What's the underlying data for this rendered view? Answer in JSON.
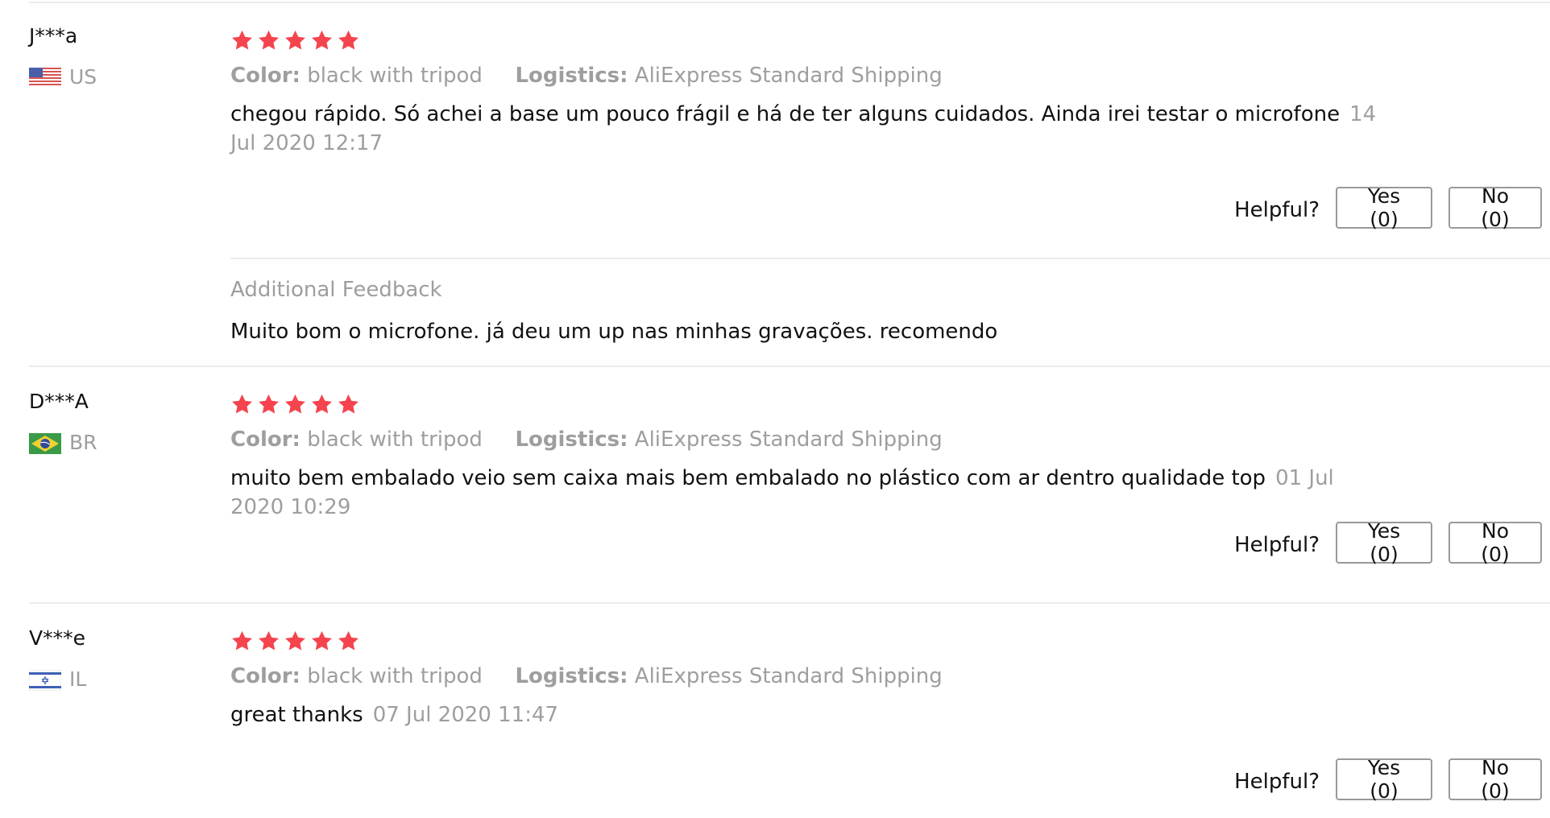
{
  "colors": {
    "star": "#f5444e",
    "muted_text": "#9e9e9e",
    "divider": "#ececec",
    "button_border": "#999999"
  },
  "rating_max": 5,
  "reviews": [
    {
      "user": "J***a",
      "country_code": "US",
      "flag_icon": "us-flag-icon",
      "rating": 5,
      "color_label": "Color:",
      "color_value": "black with tripod",
      "logistics_label": "Logistics:",
      "logistics_value": "AliExpress Standard Shipping",
      "text": "chegou rápido. Só achei a base um pouco frágil e há de ter alguns cuidados. Ainda irei testar o microfone",
      "date": "14 Jul 2020 12:17",
      "helpful_label": "Helpful?",
      "yes_label": "Yes (0)",
      "no_label": "No (0)",
      "additional_title": "Additional Feedback",
      "additional_text": "Muito bom o microfone. já deu um up nas minhas gravações. recomendo"
    },
    {
      "user": "D***A",
      "country_code": "BR",
      "flag_icon": "br-flag-icon",
      "rating": 5,
      "color_label": "Color:",
      "color_value": "black with tripod",
      "logistics_label": "Logistics:",
      "logistics_value": "AliExpress Standard Shipping",
      "text": "muito bem embalado veio sem caixa mais bem embalado no plástico com ar dentro qualidade top",
      "date": "01 Jul 2020 10:29",
      "helpful_label": "Helpful?",
      "yes_label": "Yes (0)",
      "no_label": "No (0)"
    },
    {
      "user": "V***e",
      "country_code": "IL",
      "flag_icon": "il-flag-icon",
      "rating": 5,
      "color_label": "Color:",
      "color_value": "black with tripod",
      "logistics_label": "Logistics:",
      "logistics_value": "AliExpress Standard Shipping",
      "text": "great thanks",
      "date": "07 Jul 2020 11:47",
      "helpful_label": "Helpful?",
      "yes_label": "Yes (0)",
      "no_label": "No (0)"
    }
  ]
}
